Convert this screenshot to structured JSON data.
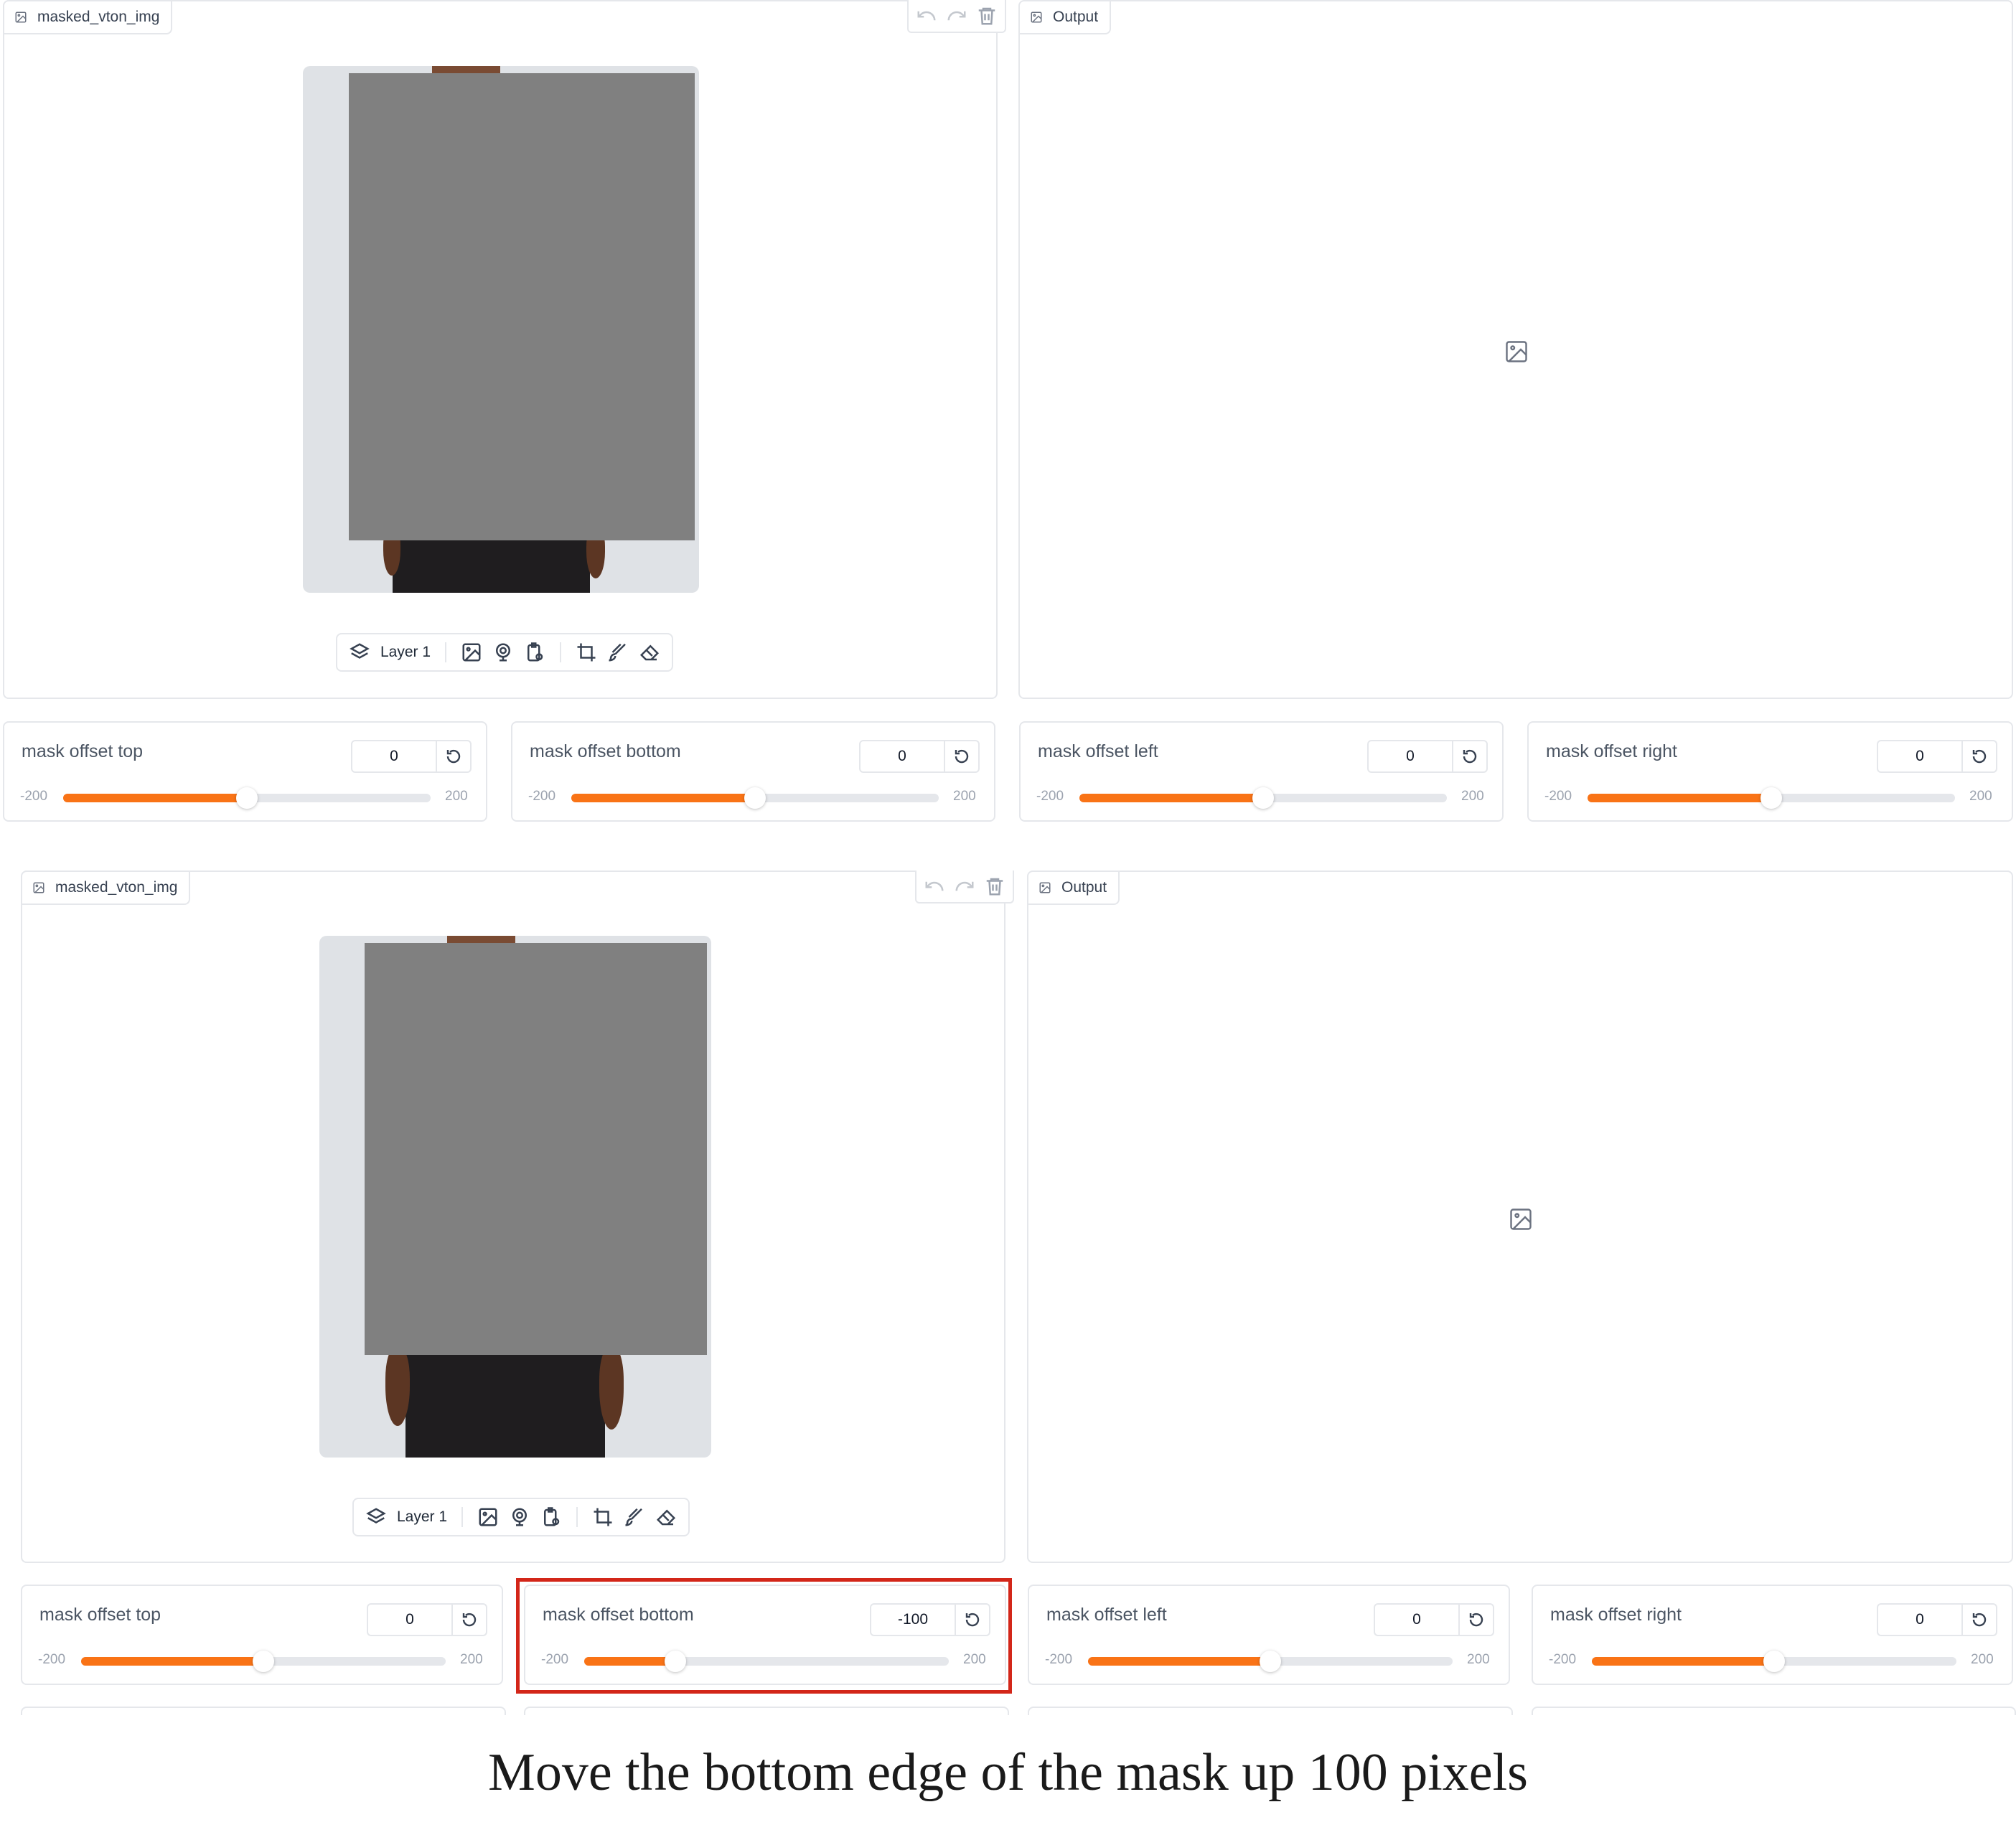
{
  "panels": [
    {
      "input_label": "masked_vton_img",
      "output_label": "Output",
      "layer_label": "Layer 1",
      "sliders": [
        {
          "label": "mask offset top",
          "value": "0",
          "min": "-200",
          "max": "200",
          "level": 0
        },
        {
          "label": "mask offset bottom",
          "value": "0",
          "min": "-200",
          "max": "200",
          "level": 0
        },
        {
          "label": "mask offset left",
          "value": "0",
          "min": "-200",
          "max": "200",
          "level": 0
        },
        {
          "label": "mask offset right",
          "value": "0",
          "min": "-200",
          "max": "200",
          "level": 0
        }
      ]
    },
    {
      "input_label": "masked_vton_img",
      "output_label": "Output",
      "layer_label": "Layer 1",
      "sliders": [
        {
          "label": "mask offset top",
          "value": "0",
          "min": "-200",
          "max": "200",
          "level": 0
        },
        {
          "label": "mask offset bottom",
          "value": "-100",
          "min": "-200",
          "max": "200",
          "level": -100
        },
        {
          "label": "mask offset left",
          "value": "0",
          "min": "-200",
          "max": "200",
          "level": 0
        },
        {
          "label": "mask offset right",
          "value": "0",
          "min": "-200",
          "max": "200",
          "level": 0
        }
      ]
    }
  ],
  "caption": "Move the bottom edge of the mask up 100 pixels",
  "colors": {
    "accent": "#f97316",
    "highlight": "#d32619",
    "border": "#e5e7eb"
  },
  "icons": [
    "image-icon",
    "undo-icon",
    "redo-icon",
    "trash-icon",
    "layers-icon",
    "upload-image-icon",
    "webcam-icon",
    "clipboard-icon",
    "crop-icon",
    "brush-icon",
    "eraser-icon",
    "reset-icon"
  ]
}
